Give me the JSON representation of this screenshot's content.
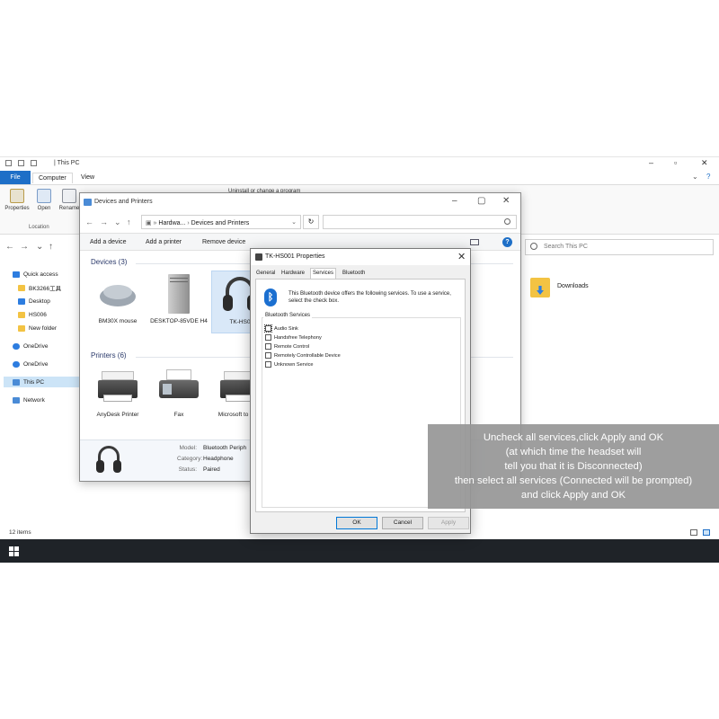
{
  "explorer": {
    "title": "| This PC",
    "ribbon_tabs": [
      "File",
      "Computer",
      "View"
    ],
    "ribbon_buttons": [
      "Properties",
      "Open",
      "Rename"
    ],
    "ribbon_group": "Location",
    "ribbon_extra": "Uninstall or change a program",
    "search_placeholder": "Search This PC",
    "nav_items": [
      "Quick access",
      "BK3266工具",
      "Desktop",
      "HS006",
      "New folder",
      "OneDrive",
      "OneDrive",
      "This PC",
      "Network"
    ],
    "downloads_label": "Downloads",
    "status": "12 items",
    "accent": "#1e6fc7"
  },
  "devices_window": {
    "title": "Devices and Printers",
    "breadcrumb": [
      "Hardwa...",
      "Devices and Printers"
    ],
    "commands": [
      "Add a device",
      "Add a printer",
      "Remove device"
    ],
    "groups": {
      "devices_header": "Devices (3)",
      "printers_header": "Printers (6)"
    },
    "devices": [
      "BM30X mouse",
      "DESKTOP-85VDE H4",
      "TK-HS0"
    ],
    "printers": [
      "AnyDesk Printer",
      "Fax",
      "Microsoft to PDF"
    ],
    "details": {
      "model_label": "Model:",
      "model_value": "Bluetooth Periph",
      "category_label": "Category:",
      "category_value": "Headphone",
      "status_label": "Status:",
      "status_value": "Paired"
    }
  },
  "properties_dialog": {
    "title": "TK-HS001 Properties",
    "tabs": [
      "General",
      "Hardware",
      "Services",
      "Bluetooth"
    ],
    "selected_tab": "Services",
    "description": "This Bluetooth device offers the following services. To use a service, select the check box.",
    "services_group": "Bluetooth Services",
    "services": [
      {
        "label": "Audio Sink",
        "checked": false
      },
      {
        "label": "Handsfree Telephony",
        "checked": false
      },
      {
        "label": "Remote Control",
        "checked": false
      },
      {
        "label": "Remotely Controllable Device",
        "checked": false
      },
      {
        "label": "Unknown Service",
        "checked": false
      }
    ],
    "buttons": {
      "ok": "OK",
      "cancel": "Cancel",
      "apply": "Apply"
    }
  },
  "overlay": {
    "lines": [
      "Uncheck all services,click Apply and OK",
      "(at which time the headset will",
      "tell you that it is Disconnected)",
      "then select all services (Connected will be prompted)",
      "and click Apply and OK"
    ]
  }
}
